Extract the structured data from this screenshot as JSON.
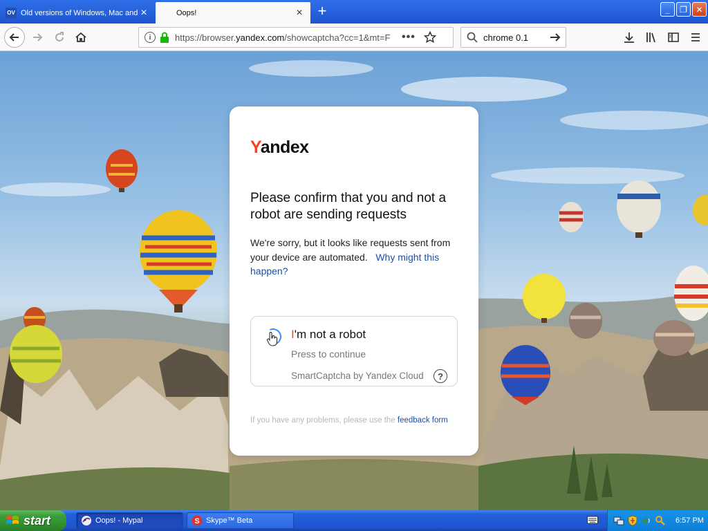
{
  "browser": {
    "tabs": [
      {
        "favicon": "OV",
        "title": "Old versions of Windows, Mac and",
        "active": false
      },
      {
        "title": "Oops!",
        "active": true
      }
    ],
    "url_prefix": "https://browser.",
    "url_domain": "yandex.com",
    "url_suffix": "/showcaptcha?cc=1&mt=F",
    "search_value": "chrome 0.1"
  },
  "page": {
    "logo_first": "Y",
    "logo_rest": "andex",
    "heading": "Please confirm that you and not a robot are sending requests",
    "description": "We're sorry, but it looks like requests sent from your device are automated.",
    "why_link": "Why might this happen?",
    "captcha": {
      "label_first": "I",
      "label_rest": "'m not a robot",
      "subtext": "Press to continue",
      "provider": "SmartCaptcha by Yandex Cloud"
    },
    "footer_text": "If you have any problems, please use the",
    "footer_link": "feedback form"
  },
  "taskbar": {
    "start_label": "start",
    "tasks": [
      {
        "label": "Oops! - Mypal",
        "icon": "mypal-icon",
        "active": true
      },
      {
        "label": "Skype™ Beta",
        "icon": "skype-icon",
        "active": false
      }
    ],
    "clock": "6:57 PM"
  },
  "colors": {
    "yandex_red": "#fc3f1d",
    "link_blue": "#1b4fa1",
    "xp_blue": "#245edb",
    "xp_green": "#3c9a3a"
  }
}
